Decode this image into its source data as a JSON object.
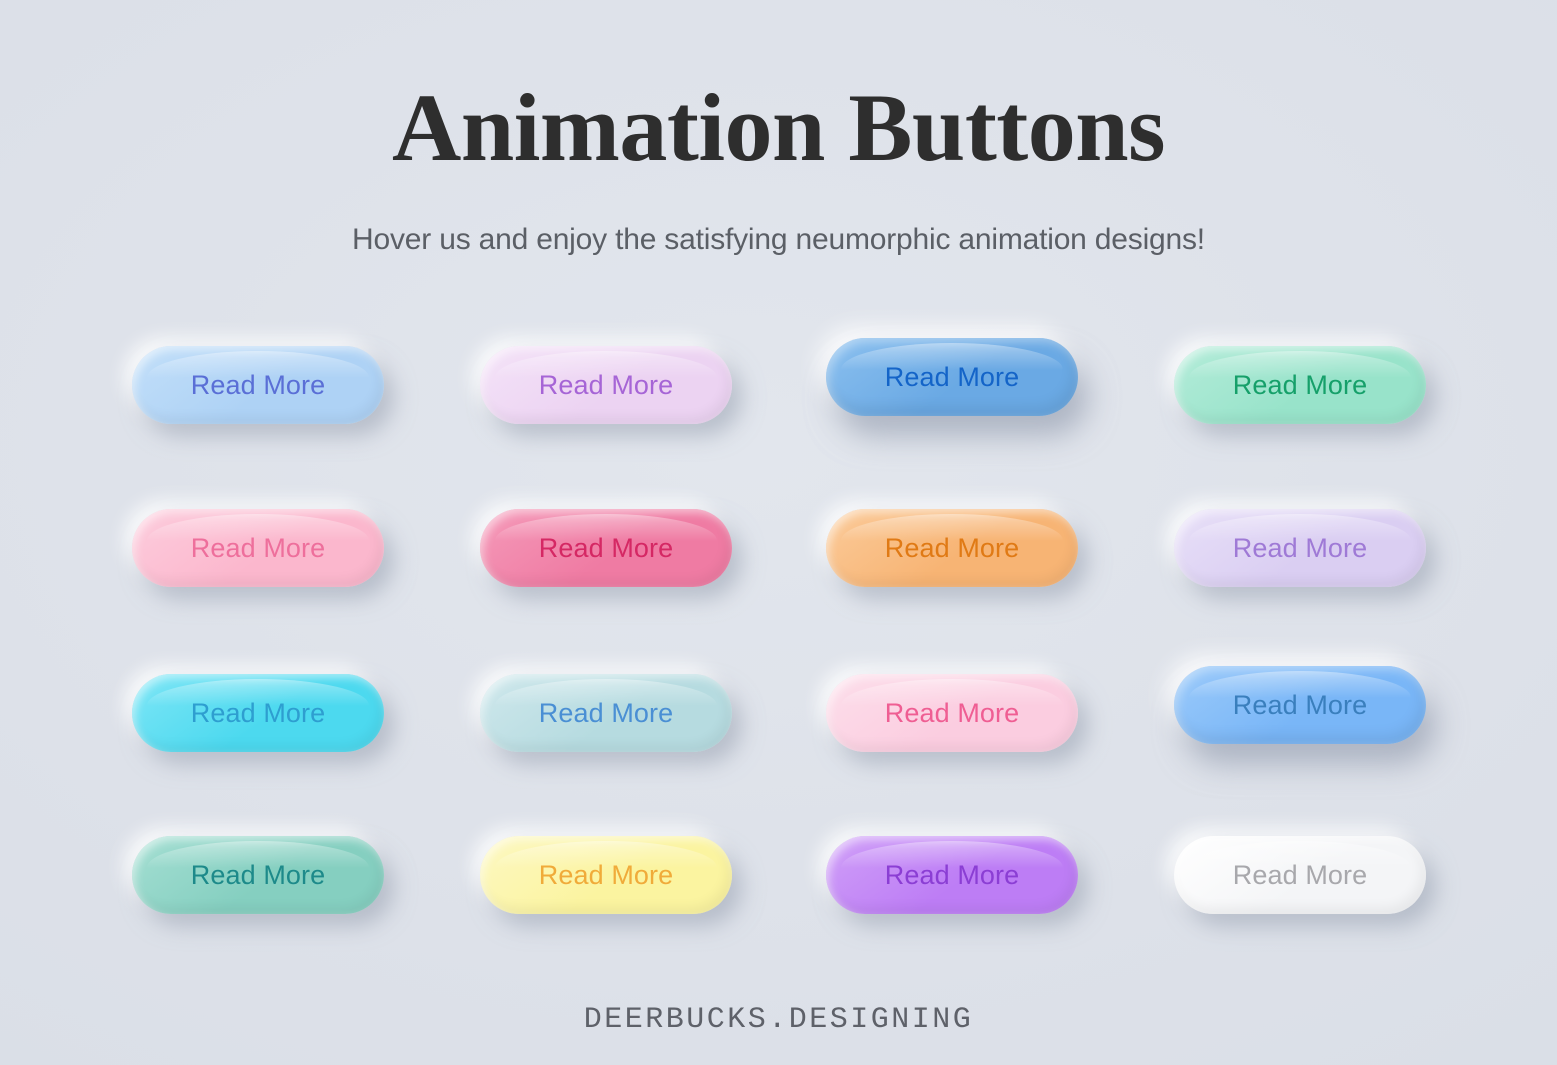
{
  "header": {
    "title": "Animation Buttons",
    "subtitle": "Hover us and enjoy the satisfying neumorphic animation designs!"
  },
  "footer": {
    "brand": "DEERBUCKS.DESIGNING"
  },
  "theme": {
    "background": "#dfe3eb",
    "title_color": "#2e2e2e",
    "subtitle_color": "#5b5f66",
    "footer_color": "#5e6169"
  },
  "buttons": [
    {
      "id": "btn-r1c1",
      "label": "Read More",
      "row": 1,
      "col": 1,
      "bg": "#aed2f5",
      "bg_light": "#c2dff9",
      "text": "#5a6fd6",
      "state": "rest"
    },
    {
      "id": "btn-r1c2",
      "label": "Read More",
      "row": 1,
      "col": 2,
      "bg": "#ecd3f2",
      "bg_light": "#f4e3f8",
      "text": "#a665d6",
      "state": "rest"
    },
    {
      "id": "btn-r1c3",
      "label": "Read More",
      "row": 1,
      "col": 3,
      "bg": "#6aa9e4",
      "bg_light": "#8bc0ef",
      "text": "#1464c8",
      "state": "hover"
    },
    {
      "id": "btn-r1c4",
      "label": "Read More",
      "row": 1,
      "col": 4,
      "bg": "#98e3ca",
      "bg_light": "#b4ecd9",
      "text": "#16a06a",
      "state": "rest"
    },
    {
      "id": "btn-r2c1",
      "label": "Read More",
      "row": 2,
      "col": 1,
      "bg": "#fbb7cd",
      "bg_light": "#fdcddd",
      "text": "#ee6f9c",
      "state": "rest"
    },
    {
      "id": "btn-r2c2",
      "label": "Read More",
      "row": 2,
      "col": 2,
      "bg": "#ef7ba3",
      "bg_light": "#f59ab9",
      "text": "#d52864",
      "state": "rest"
    },
    {
      "id": "btn-r2c3",
      "label": "Read More",
      "row": 2,
      "col": 3,
      "bg": "#f7b474",
      "bg_light": "#fbcb9a",
      "text": "#e07a15",
      "state": "rest"
    },
    {
      "id": "btn-r2c4",
      "label": "Read More",
      "row": 2,
      "col": 4,
      "bg": "#dacef2",
      "bg_light": "#e8e0f8",
      "text": "#9f7ad6",
      "state": "rest"
    },
    {
      "id": "btn-r3c1",
      "label": "Read More",
      "row": 3,
      "col": 1,
      "bg": "#4cd9ef",
      "bg_light": "#7ee6f6",
      "text": "#2e9ed0",
      "state": "rest"
    },
    {
      "id": "btn-r3c2",
      "label": "Read More",
      "row": 3,
      "col": 2,
      "bg": "#b6dbe0",
      "bg_light": "#cfe8ec",
      "text": "#4a8fd4",
      "state": "rest"
    },
    {
      "id": "btn-r3c3",
      "label": "Read More",
      "row": 3,
      "col": 3,
      "bg": "#fbcde0",
      "bg_light": "#fddfeb",
      "text": "#ef5e93",
      "state": "rest"
    },
    {
      "id": "btn-r3c4",
      "label": "Read More",
      "row": 3,
      "col": 4,
      "bg": "#79b6f7",
      "bg_light": "#9bcafa",
      "text": "#3a7fbd",
      "state": "hover"
    },
    {
      "id": "btn-r4c1",
      "label": "Read More",
      "row": 4,
      "col": 1,
      "bg": "#85cfc0",
      "bg_light": "#a5dfd3",
      "text": "#1d8a8a",
      "state": "rest"
    },
    {
      "id": "btn-r4c2",
      "label": "Read More",
      "row": 4,
      "col": 2,
      "bg": "#fbf4a0",
      "bg_light": "#fdf8c2",
      "text": "#f0ab3a",
      "state": "rest"
    },
    {
      "id": "btn-r4c3",
      "label": "Read More",
      "row": 4,
      "col": 3,
      "bg": "#bd7df5",
      "bg_light": "#d0a0f8",
      "text": "#8b3ed4",
      "state": "rest"
    },
    {
      "id": "btn-r4c4",
      "label": "Read More",
      "row": 4,
      "col": 4,
      "bg": "#f4f5f7",
      "bg_light": "#ffffff",
      "text": "#a8a8ac",
      "state": "rest"
    }
  ]
}
